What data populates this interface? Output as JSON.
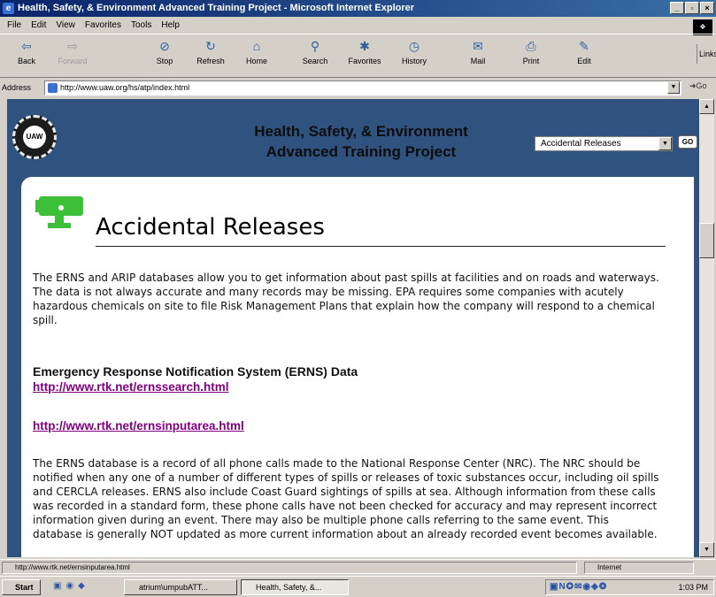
{
  "window": {
    "title": "Health, Safety, & Environment Advanced Training Project - Microsoft Internet Explorer"
  },
  "menu": [
    "File",
    "Edit",
    "View",
    "Favorites",
    "Tools",
    "Help"
  ],
  "toolbar": [
    {
      "label": "Back",
      "icon": "back-arrow-icon",
      "glyph": "⇦"
    },
    {
      "label": "Forward",
      "icon": "forward-arrow-icon",
      "glyph": "⇨"
    },
    {
      "label": "Stop",
      "icon": "stop-icon",
      "glyph": "⊘"
    },
    {
      "label": "Refresh",
      "icon": "refresh-icon",
      "glyph": "↻"
    },
    {
      "label": "Home",
      "icon": "home-icon",
      "glyph": "⌂"
    },
    {
      "label": "Search",
      "icon": "search-icon",
      "glyph": "⚲"
    },
    {
      "label": "Favorites",
      "icon": "favorites-icon",
      "glyph": "✱"
    },
    {
      "label": "History",
      "icon": "history-icon",
      "glyph": "◷"
    },
    {
      "label": "Mail",
      "icon": "mail-icon",
      "glyph": "✉"
    },
    {
      "label": "Print",
      "icon": "print-icon",
      "glyph": "⎙"
    },
    {
      "label": "Edit",
      "icon": "edit-icon",
      "glyph": "✎"
    }
  ],
  "links_label": "Links",
  "address": {
    "label": "Address",
    "url": "http://www.uaw.org/hs/atp/index.html",
    "go": "Go"
  },
  "banner": {
    "seal_text": "UAW",
    "title_line1": "Health, Safety, & Environment",
    "title_line2": "Advanced Training Project",
    "select_value": "Accidental Releases",
    "go_label": "GO"
  },
  "page": {
    "title": "Accidental Releases",
    "intro": "The ERNS and ARIP databases allow you to get information about past spills at facilities and on roads and waterways. The data is not always accurate and many records may be missing. EPA requires some companies with acutely hazardous chemicals on site to file Risk Management Plans that explain how the company will respond to a chemical spill.",
    "section_heading": "Emergency Response Notification System (ERNS) Data",
    "link1": "http://www.rtk.net/ernssearch.html",
    "link2": "http://www.rtk.net/ernsinputarea.html",
    "body": "The ERNS database is a record of all phone calls made to the National Response Center (NRC). The NRC should be notified when any one of a number of different types of spills or releases of toxic substances occur, including oil spills and CERCLA releases. ERNS also include Coast Guard sightings of spills at sea. Although information from these calls was recorded in a standard form, these phone calls have not been checked for accuracy and may represent incorrect information given during an event. There may also be multiple phone calls referring to the same event. This database is generally NOT updated as more current information about an already recorded event becomes available."
  },
  "status": {
    "text": "http://www.rtk.net/ernsinputarea.html",
    "zone": "Internet"
  },
  "taskbar": {
    "start": "Start",
    "items": [
      "atrium\\umpubATT...",
      "Health, Safety, &..."
    ],
    "clock": "1:03 PM"
  },
  "colors": {
    "banner": "#30527f",
    "link": "#800080",
    "titlebar": "#0a246a"
  }
}
